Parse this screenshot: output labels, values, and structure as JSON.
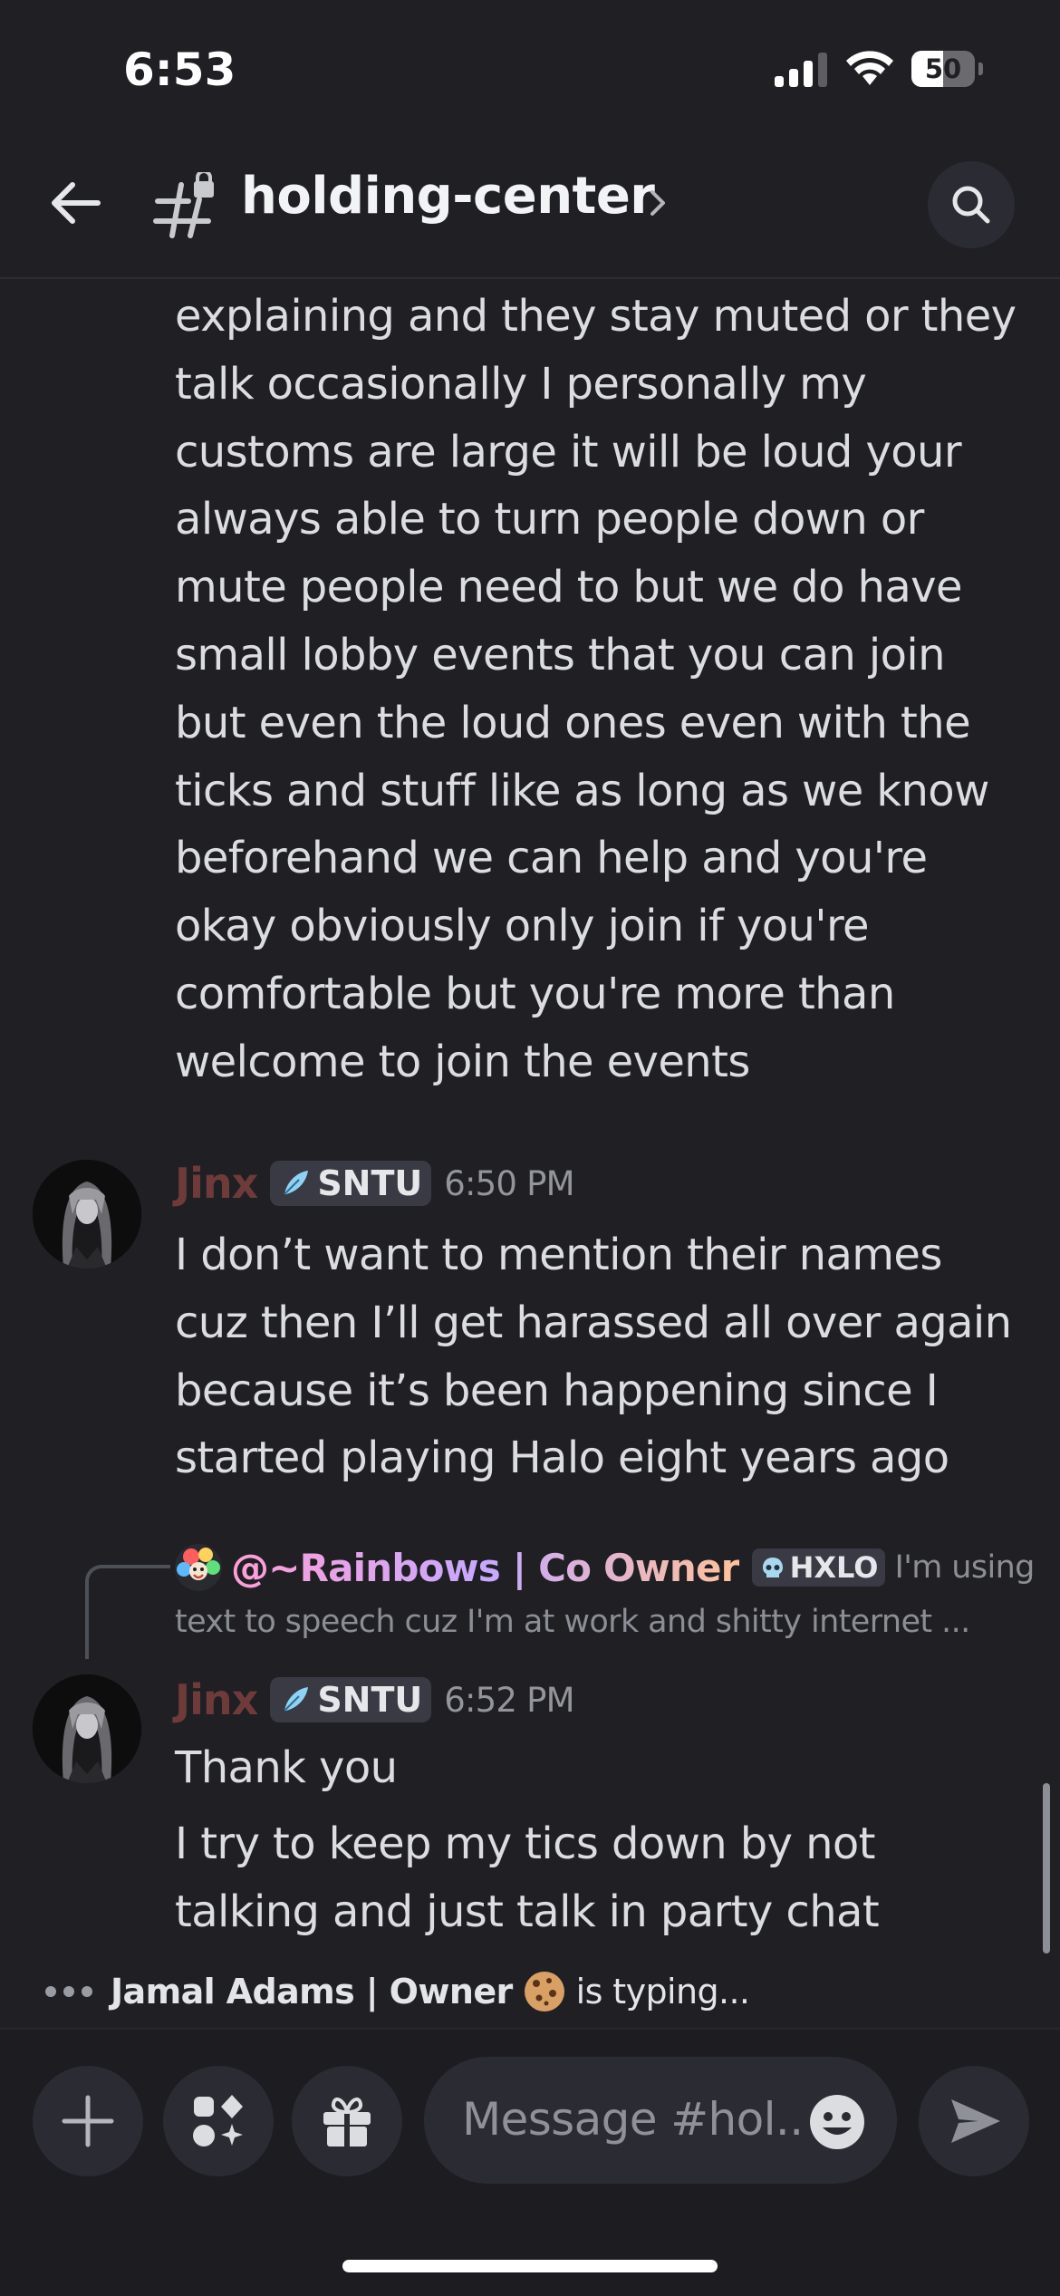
{
  "status_bar": {
    "time": "6:53",
    "battery_percent": "50",
    "battery_level": 0.5,
    "signal_bars": 3,
    "icons": [
      "signal-icon",
      "wifi-icon",
      "battery-icon"
    ]
  },
  "header": {
    "channel_name": "holding-center",
    "icons": [
      "back-arrow-icon",
      "locked-channel-icon",
      "chevron-right-icon",
      "search-icon"
    ]
  },
  "messages": {
    "continued_lines": [
      "explaining and they stay muted or they",
      "talk occasionally I personally my",
      "customs are large it will be loud your",
      "always able to turn people down or",
      "mute people need to but we do have",
      "small lobby events that you can join",
      "but even the loud ones even with the",
      "ticks and stuff like as long as we know",
      "beforehand we can help and you're",
      "okay obviously only join if you're",
      "comfortable but you're more than",
      "welcome to join the events"
    ],
    "msg1": {
      "author": "Jinx",
      "tag": "SNTU",
      "time": "6:50 PM",
      "lines": [
        "I don’t want to mention their names",
        "cuz then I’ll get harassed all over again",
        "because it’s been happening since I",
        "started playing Halo eight years ago"
      ]
    },
    "reply": {
      "author": "@~Rainbows | Co Owner",
      "tag": "HXLO",
      "preview_start": "I'm using",
      "preview_rest": "text to speech cuz I'm at work and shitty internet ..."
    },
    "msg2": {
      "author": "Jinx",
      "tag": "SNTU",
      "time": "6:52 PM",
      "text1": "Thank you",
      "lines": [
        "I try to keep my tics down by not",
        "talking and just talk in party chat"
      ]
    }
  },
  "typing": {
    "user": "Jamal Adams | Owner",
    "suffix": "is typing..."
  },
  "composer": {
    "placeholder": "Message #hol..",
    "icons": [
      "plus-icon",
      "apps-icon",
      "gift-icon",
      "emoji-icon",
      "send-icon"
    ]
  },
  "colors": {
    "background": "#1f1f24",
    "author_color": "#6e3a3a",
    "text": "#dcdde1",
    "muted": "#94959c"
  }
}
